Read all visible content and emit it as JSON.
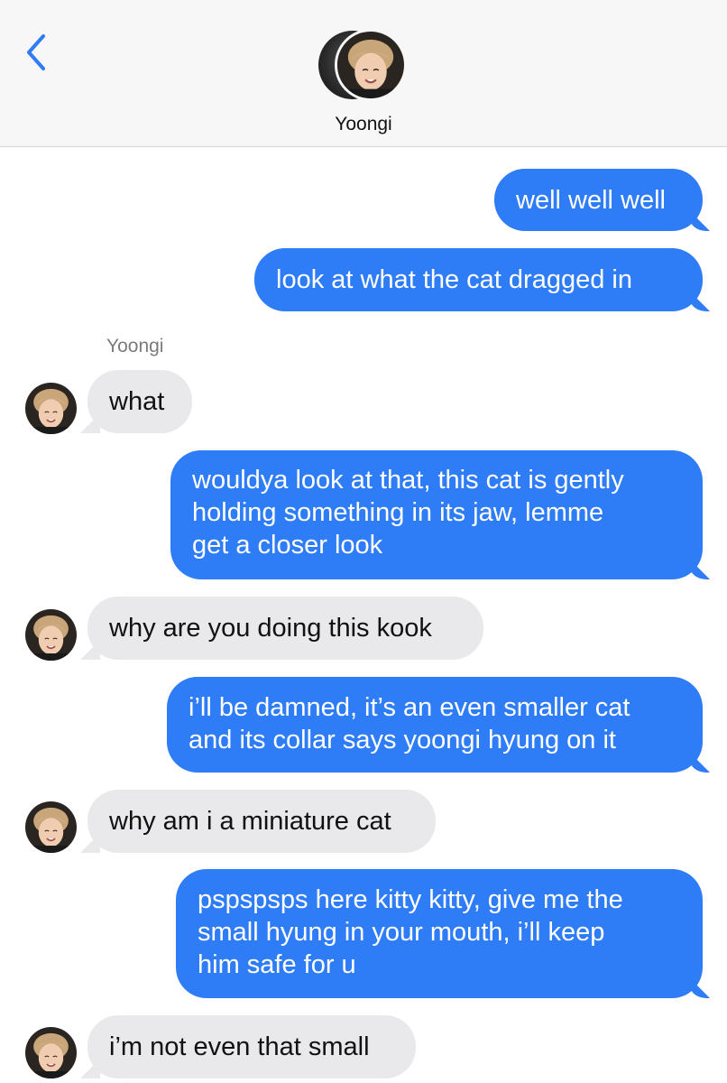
{
  "header": {
    "contact_name": "Yoongi"
  },
  "icons": {
    "back": "chevron-left-icon",
    "contact_avatar": "avatar",
    "sender_avatar": "avatar"
  },
  "colors": {
    "outgoing": "#2e7cf6",
    "incoming": "#e9e9eb",
    "accent": "#2f7cf6"
  },
  "thread": {
    "sender_label": "Yoongi",
    "messages": [
      {
        "from": "me",
        "lines": [
          "well well well"
        ]
      },
      {
        "from": "me",
        "lines": [
          "look at what the cat dragged in"
        ]
      },
      {
        "from": "them",
        "lines": [
          "what"
        ]
      },
      {
        "from": "me",
        "lines": [
          "wouldya look at that, this cat is gently",
          "holding something in its jaw, lemme",
          "get a closer look"
        ]
      },
      {
        "from": "them",
        "lines": [
          "why are you doing this kook"
        ]
      },
      {
        "from": "me",
        "lines": [
          "i’ll be damned, it’s an even smaller cat",
          "and its collar says yoongi hyung on it"
        ]
      },
      {
        "from": "them",
        "lines": [
          "why am i a miniature cat"
        ]
      },
      {
        "from": "me",
        "lines": [
          "pspspsps here kitty kitty, give me the",
          "small hyung in your mouth, i’ll keep",
          "him safe for u"
        ]
      },
      {
        "from": "them",
        "lines": [
          "i’m not even that small"
        ]
      }
    ]
  }
}
